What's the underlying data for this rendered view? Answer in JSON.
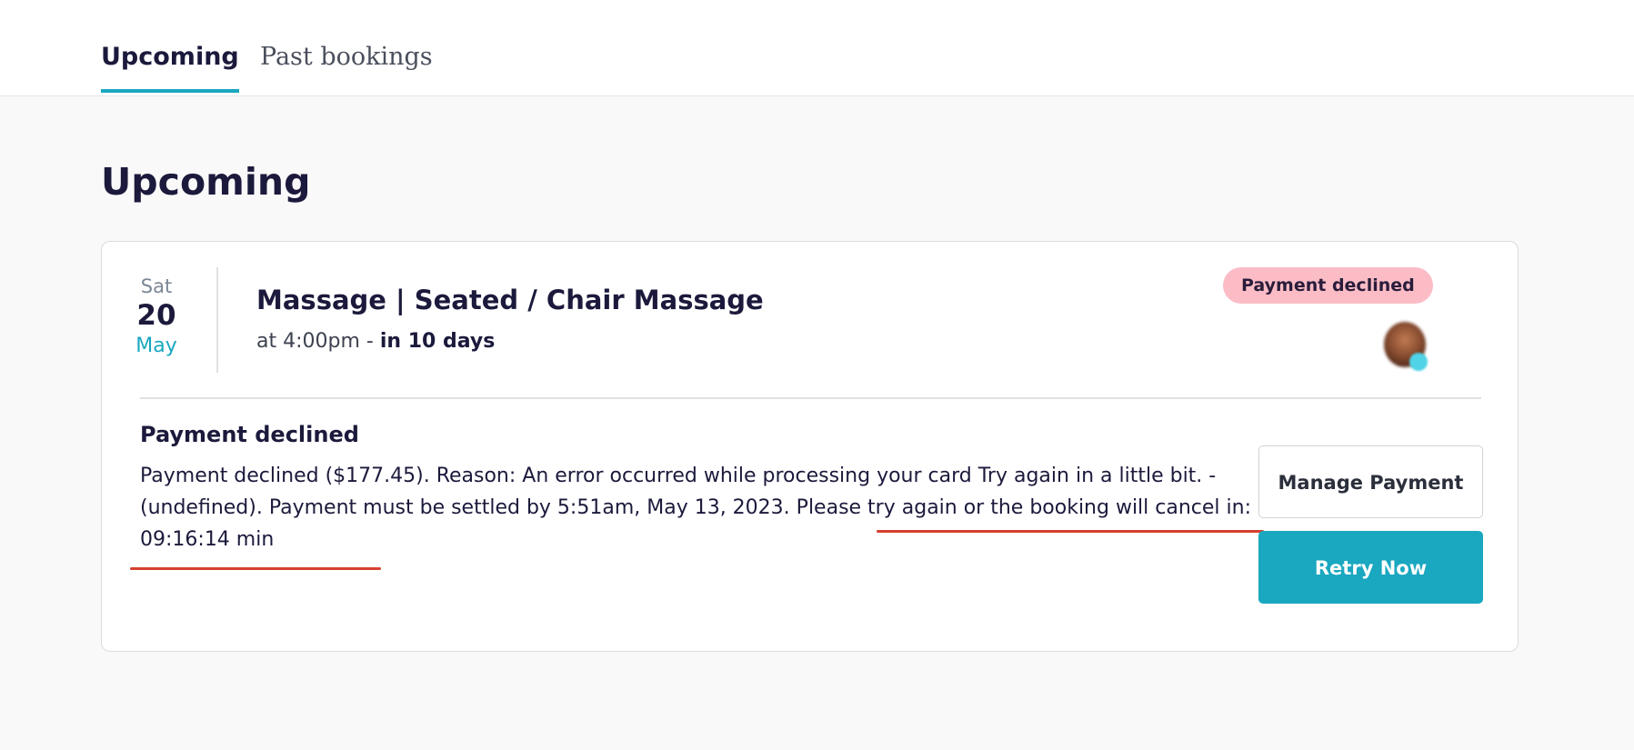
{
  "tabs": {
    "upcoming_label": "Upcoming",
    "past_label": "Past bookings"
  },
  "page": {
    "title": "Upcoming"
  },
  "booking": {
    "date": {
      "weekday": "Sat",
      "day": "20",
      "month": "May"
    },
    "title": "Massage | Seated / Chair Massage",
    "time_prefix": "at 4:00pm - ",
    "time_relative": "in 10 days",
    "status_badge": "Payment declined"
  },
  "payment_notice": {
    "heading": "Payment declined",
    "message_part1": "Payment declined ($177.45). Reason: An error occurred while processing your card Try again in a little bit. - (undefined). Payment must be settled by 5:51am, May 13, 2023. ",
    "message_part2": "Please try again or the booking will cancel in: 09:16:14 min"
  },
  "actions": {
    "manage_label": "Manage Payment",
    "retry_label": "Retry Now"
  },
  "colors": {
    "accent": "#1aa7c0",
    "badge_bg": "#fbbcc6",
    "annotation_underline": "#d6402f"
  }
}
